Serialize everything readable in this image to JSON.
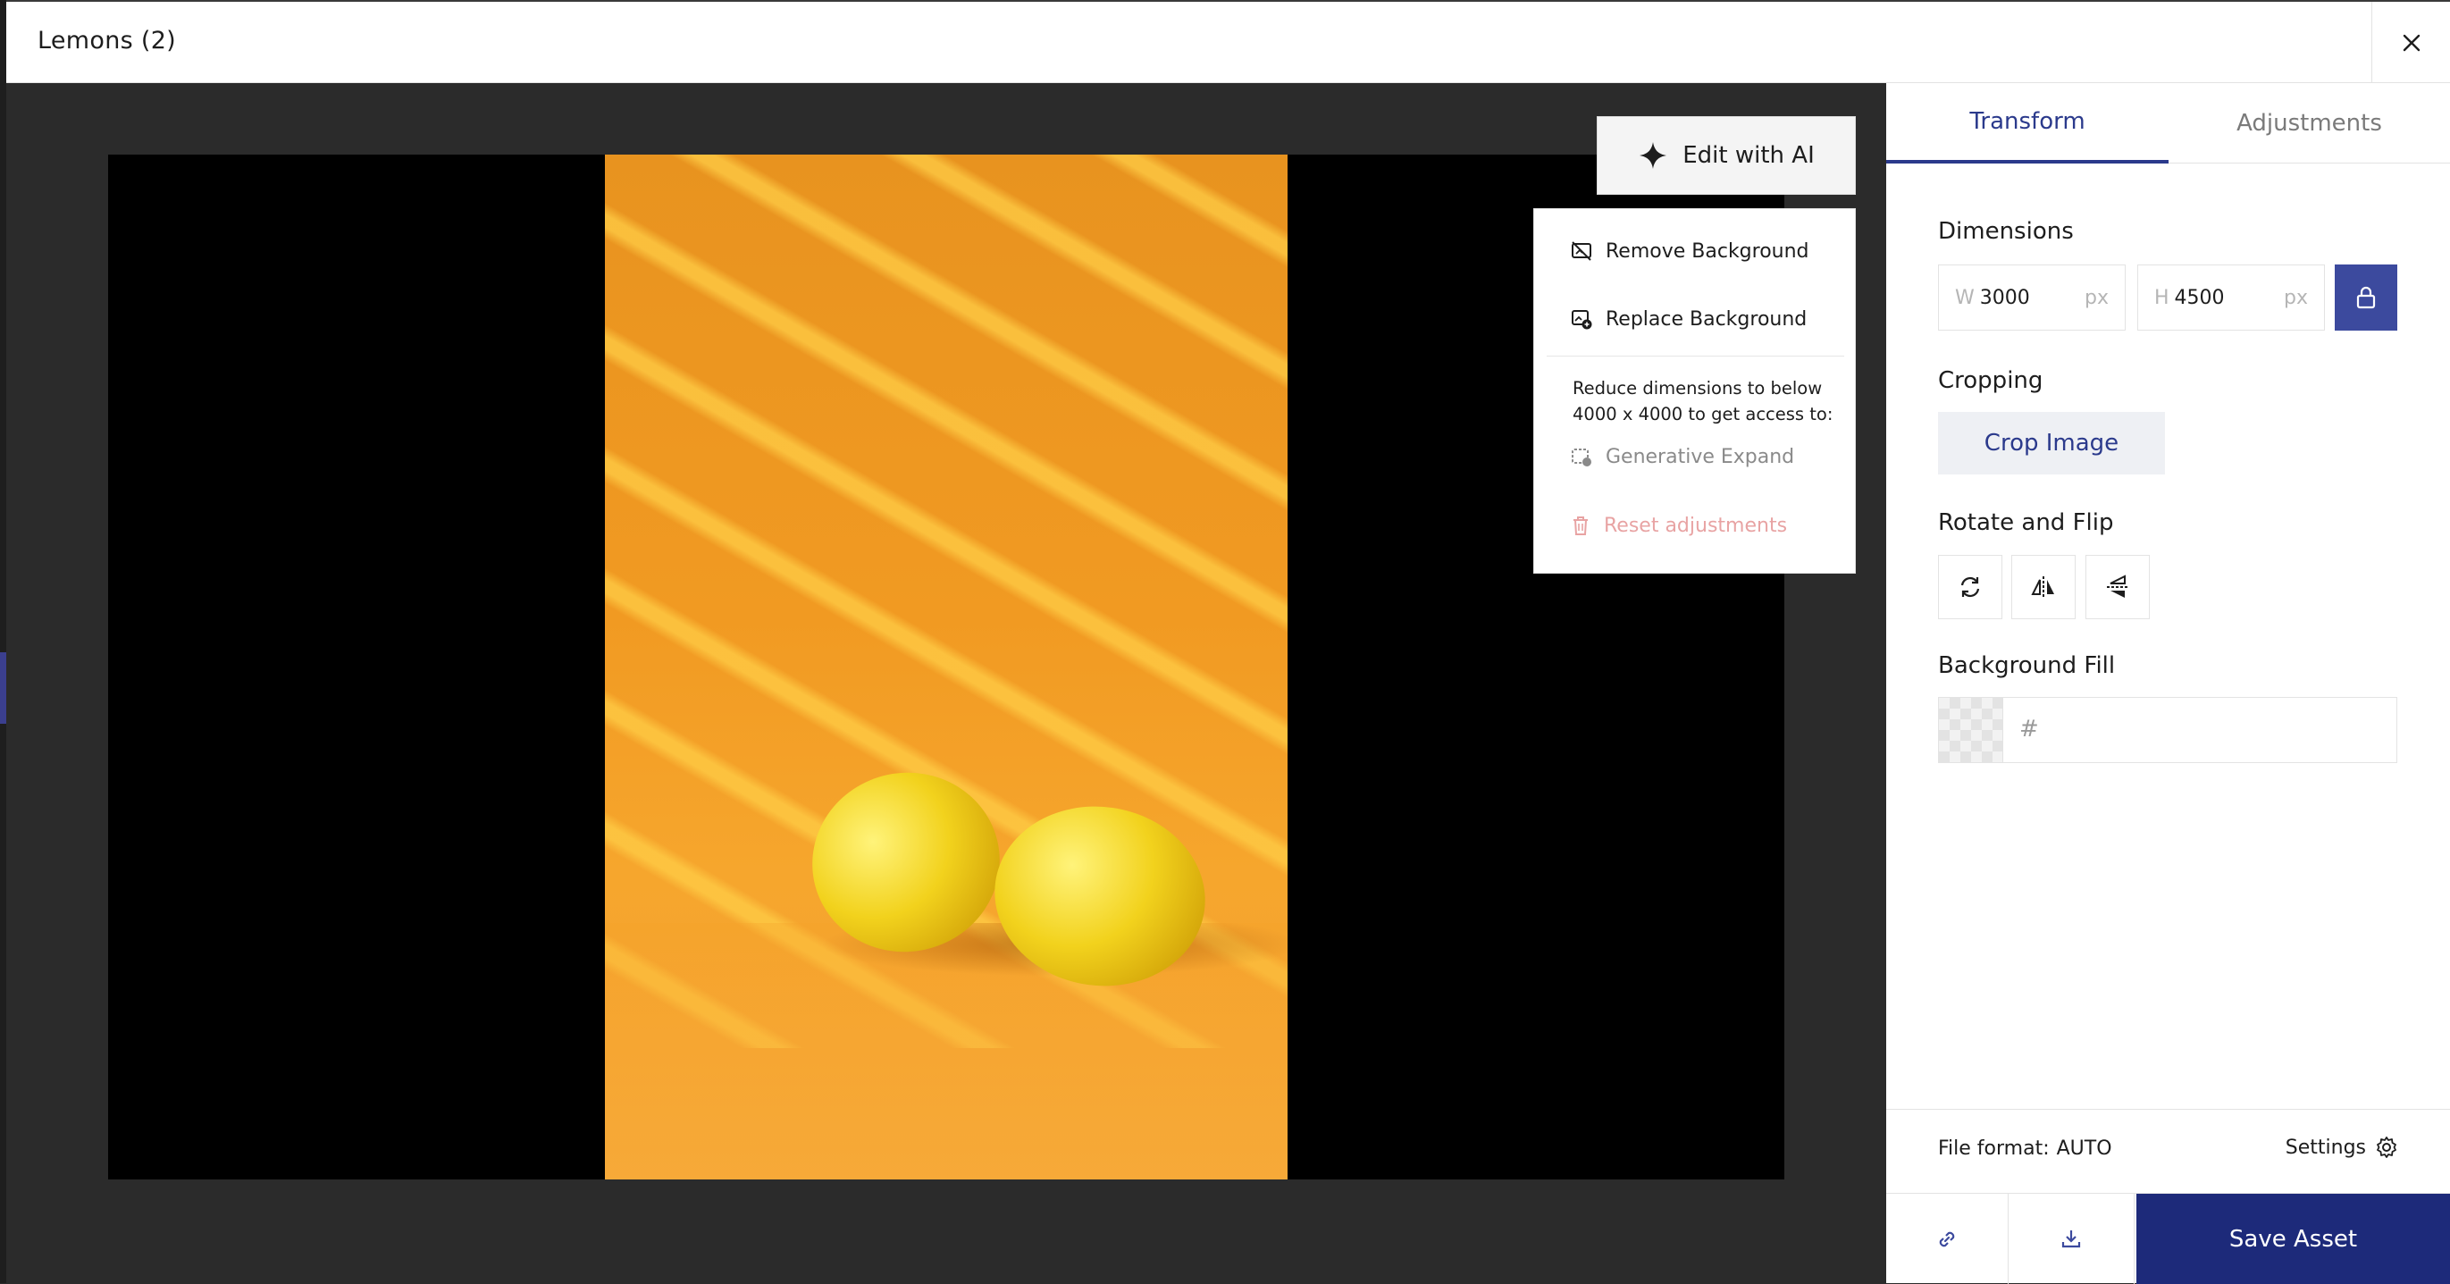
{
  "window": {
    "title": "Lemons (2)"
  },
  "ai_menu": {
    "button_label": "Edit with AI",
    "items": [
      {
        "label": "Remove Background",
        "icon": "remove-background-icon"
      },
      {
        "label": "Replace Background",
        "icon": "replace-background-icon"
      }
    ],
    "note": "Reduce dimensions to below 4000 x 4000 to get access to:",
    "disabled_item": "Generative Expand",
    "reset_label": "Reset adjustments"
  },
  "panel": {
    "tabs": [
      {
        "label": "Transform",
        "active": true
      },
      {
        "label": "Adjustments",
        "active": false
      }
    ],
    "dimensions": {
      "label": "Dimensions",
      "width": {
        "prefix": "W",
        "value": "3000",
        "unit": "px"
      },
      "height": {
        "prefix": "H",
        "value": "4500",
        "unit": "px"
      }
    },
    "cropping": {
      "label": "Cropping",
      "button": "Crop Image"
    },
    "rotate": {
      "label": "Rotate and Flip"
    },
    "background_fill": {
      "label": "Background Fill",
      "hash": "#",
      "value": ""
    },
    "file_format": {
      "label": "File format:",
      "value": "AUTO"
    },
    "settings_label": "Settings",
    "save_label": "Save Asset"
  },
  "colors": {
    "accent": "#2b3a8c",
    "save_button": "#1d2a7a",
    "lock_button": "#3c4a9e",
    "danger_text": "#e8a3a3"
  }
}
